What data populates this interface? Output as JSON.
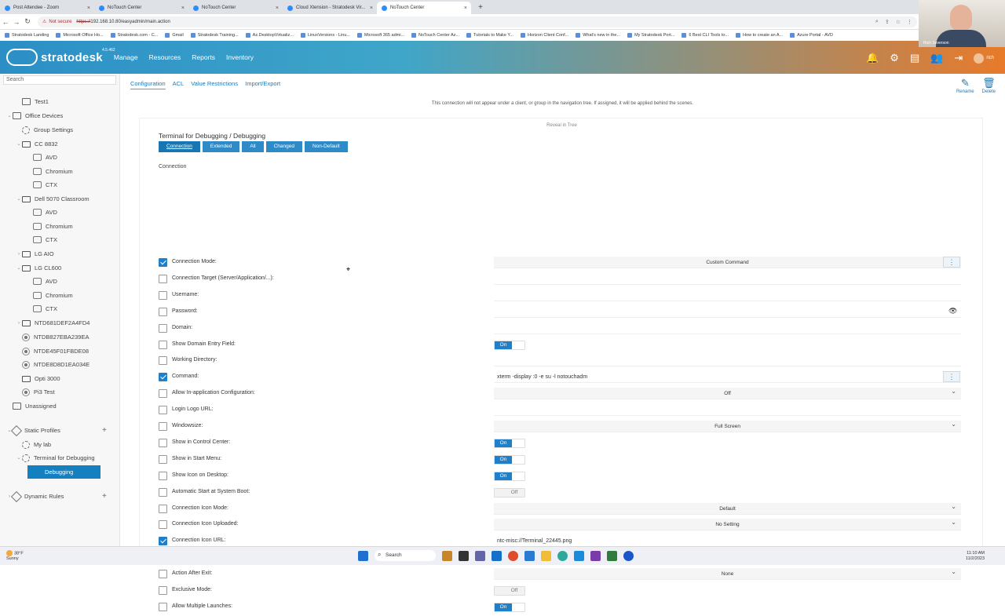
{
  "browser": {
    "tabs": [
      {
        "title": "Post Attendee - Zoom",
        "active": false
      },
      {
        "title": "NoTouch Center",
        "active": false
      },
      {
        "title": "NoTouch Center",
        "active": false
      },
      {
        "title": "Cloud Xtension - Stratodesk Vir...",
        "active": false
      },
      {
        "title": "NoTouch Center",
        "active": true
      }
    ],
    "security_label": "Not secure",
    "url_scheme": "https://",
    "url_rest": "192.168.10.80/easyadmin/main.action",
    "bookmarks": [
      "Stratodesk Landing",
      "Microsoft Office Ho...",
      "Stratodesk.com - C...",
      "Gmail",
      "Stratodesk Training...",
      "Az.DesktopVirtualiz...",
      "LinuxVersions - Linu...",
      "Microsoft 365 admi...",
      "NoTouch Center Az...",
      "Tutorials to Make Y...",
      "Horizon Client Conf...",
      "What's new in the...",
      "My Stratodesk Port...",
      "6 Best CLI Tools to...",
      "How to create an A...",
      "Azure Portal - AVD"
    ]
  },
  "header": {
    "brand": "stratodesk",
    "version": "4.5.462",
    "nav": [
      "Manage",
      "Resources",
      "Reports",
      "Inventory"
    ],
    "user": "rich",
    "accent": "#2b8fc6",
    "accent2": "#e87a2a"
  },
  "webcam": {
    "name": "Rich Severson"
  },
  "sidebar": {
    "search_placeholder": "Search",
    "items": [
      {
        "label": "Test1",
        "icon": "folder-icon"
      },
      {
        "label": "Office Devices",
        "icon": "folder-icon"
      },
      {
        "label": "Group Settings",
        "icon": "gear-icon"
      },
      {
        "label": "CC 8832",
        "icon": "monitor-icon"
      },
      {
        "label": "AVD",
        "icon": "cube-icon"
      },
      {
        "label": "Chromium",
        "icon": "cube-icon"
      },
      {
        "label": "CTX",
        "icon": "cube-icon"
      },
      {
        "label": "Dell 5070 Classroom",
        "icon": "monitor-icon"
      },
      {
        "label": "AVD",
        "icon": "cube-icon"
      },
      {
        "label": "Chromium",
        "icon": "cube-icon"
      },
      {
        "label": "CTX",
        "icon": "cube-icon"
      },
      {
        "label": "LG AIO",
        "icon": "monitor-icon"
      },
      {
        "label": "LG CL600",
        "icon": "monitor-icon"
      },
      {
        "label": "AVD",
        "icon": "cube-icon"
      },
      {
        "label": "Chromium",
        "icon": "cube-icon"
      },
      {
        "label": "CTX",
        "icon": "cube-icon"
      },
      {
        "label": "NTD681DEF2A4FD4",
        "icon": "monitor-icon"
      },
      {
        "label": "NTDB827EBA239EA",
        "icon": "pi-icon"
      },
      {
        "label": "NTDE45F01FBDE08",
        "icon": "pi-icon"
      },
      {
        "label": "NTDE8D8D1EA034E",
        "icon": "pi-icon"
      },
      {
        "label": "Opti 3000",
        "icon": "monitor-icon"
      },
      {
        "label": "Pi3 Test",
        "icon": "pi-icon"
      },
      {
        "label": "Unassigned",
        "icon": "folder-icon"
      },
      {
        "label": "Static Profiles",
        "icon": "profile-icon"
      },
      {
        "label": "My lab",
        "icon": "gear-icon"
      },
      {
        "label": "Terminal for Debugging",
        "icon": "gear-icon"
      },
      {
        "label": "Debugging",
        "icon": "cube-icon"
      },
      {
        "label": "Dynamic Rules",
        "icon": "profile-icon"
      }
    ]
  },
  "content": {
    "subnav": [
      "Configuration",
      "ACL",
      "Value Restrictions",
      "Import/Export"
    ],
    "rename": "Rename",
    "delete": "Delete",
    "notice": "This connection will not appear under a client, or group in the navigation tree. If assigned, it will be applied behind the scenes.",
    "reveal": "Reveal in Tree",
    "title": "Terminal for Debugging / Debugging",
    "filter_tabs": [
      "Connection",
      "Extended",
      "All",
      "Changed",
      "Non-Default"
    ],
    "section": "Connection",
    "rows": [
      {
        "label": "Connection Mode:",
        "checked": true,
        "type": "select",
        "value": "Custom Command",
        "kebab": true
      },
      {
        "label": "Connection Target (Server/Application/...):",
        "checked": false,
        "type": "text",
        "value": ""
      },
      {
        "label": "Username:",
        "checked": false,
        "type": "text",
        "value": ""
      },
      {
        "label": "Password:",
        "checked": false,
        "type": "password",
        "value": ""
      },
      {
        "label": "Domain:",
        "checked": false,
        "type": "text",
        "value": ""
      },
      {
        "label": "Show Domain Entry Field:",
        "checked": false,
        "type": "toggle",
        "value": "On"
      },
      {
        "label": "Working Directory:",
        "checked": false,
        "type": "text",
        "value": ""
      },
      {
        "label": "Command:",
        "checked": true,
        "type": "text",
        "value": "xterm -display :0 -e su -l notouchadm",
        "kebab": true
      },
      {
        "label": "Allow In-application Configuration:",
        "checked": false,
        "type": "select",
        "value": "Off"
      },
      {
        "label": "Login Logo URL:",
        "checked": false,
        "type": "text",
        "value": ""
      },
      {
        "label": "Windowsize:",
        "checked": false,
        "type": "select",
        "value": "Full Screen"
      },
      {
        "label": "Show in Control Center:",
        "checked": false,
        "type": "toggle",
        "value": "On"
      },
      {
        "label": "Show in Start Menu:",
        "checked": false,
        "type": "toggle",
        "value": "On"
      },
      {
        "label": "Show Icon on Desktop:",
        "checked": false,
        "type": "toggle",
        "value": "On"
      },
      {
        "label": "Automatic Start at System Boot:",
        "checked": false,
        "type": "toggle",
        "value": "Off"
      },
      {
        "label": "Connection Icon Mode:",
        "checked": false,
        "type": "select",
        "value": "Default"
      },
      {
        "label": "Connection Icon Uploaded:",
        "checked": false,
        "type": "select",
        "value": "No Setting"
      },
      {
        "label": "Connection Icon URL:",
        "checked": true,
        "type": "text",
        "value": "ntc-misc://Terminal_22445.png"
      },
      {
        "label": "Pin to Start Menu:",
        "checked": false,
        "type": "toggle",
        "value": "Off"
      },
      {
        "label": "Action After Exit:",
        "checked": false,
        "type": "select",
        "value": "None"
      },
      {
        "label": "Exclusive Mode:",
        "checked": false,
        "type": "toggle",
        "value": "Off"
      },
      {
        "label": "Allow Multiple Launches:",
        "checked": false,
        "type": "toggle",
        "value": "On"
      }
    ]
  },
  "taskbar": {
    "temp": "38°F",
    "weather": "Sunny",
    "search": "Search",
    "time": "11:10 AM",
    "date": "11/2/2023"
  }
}
